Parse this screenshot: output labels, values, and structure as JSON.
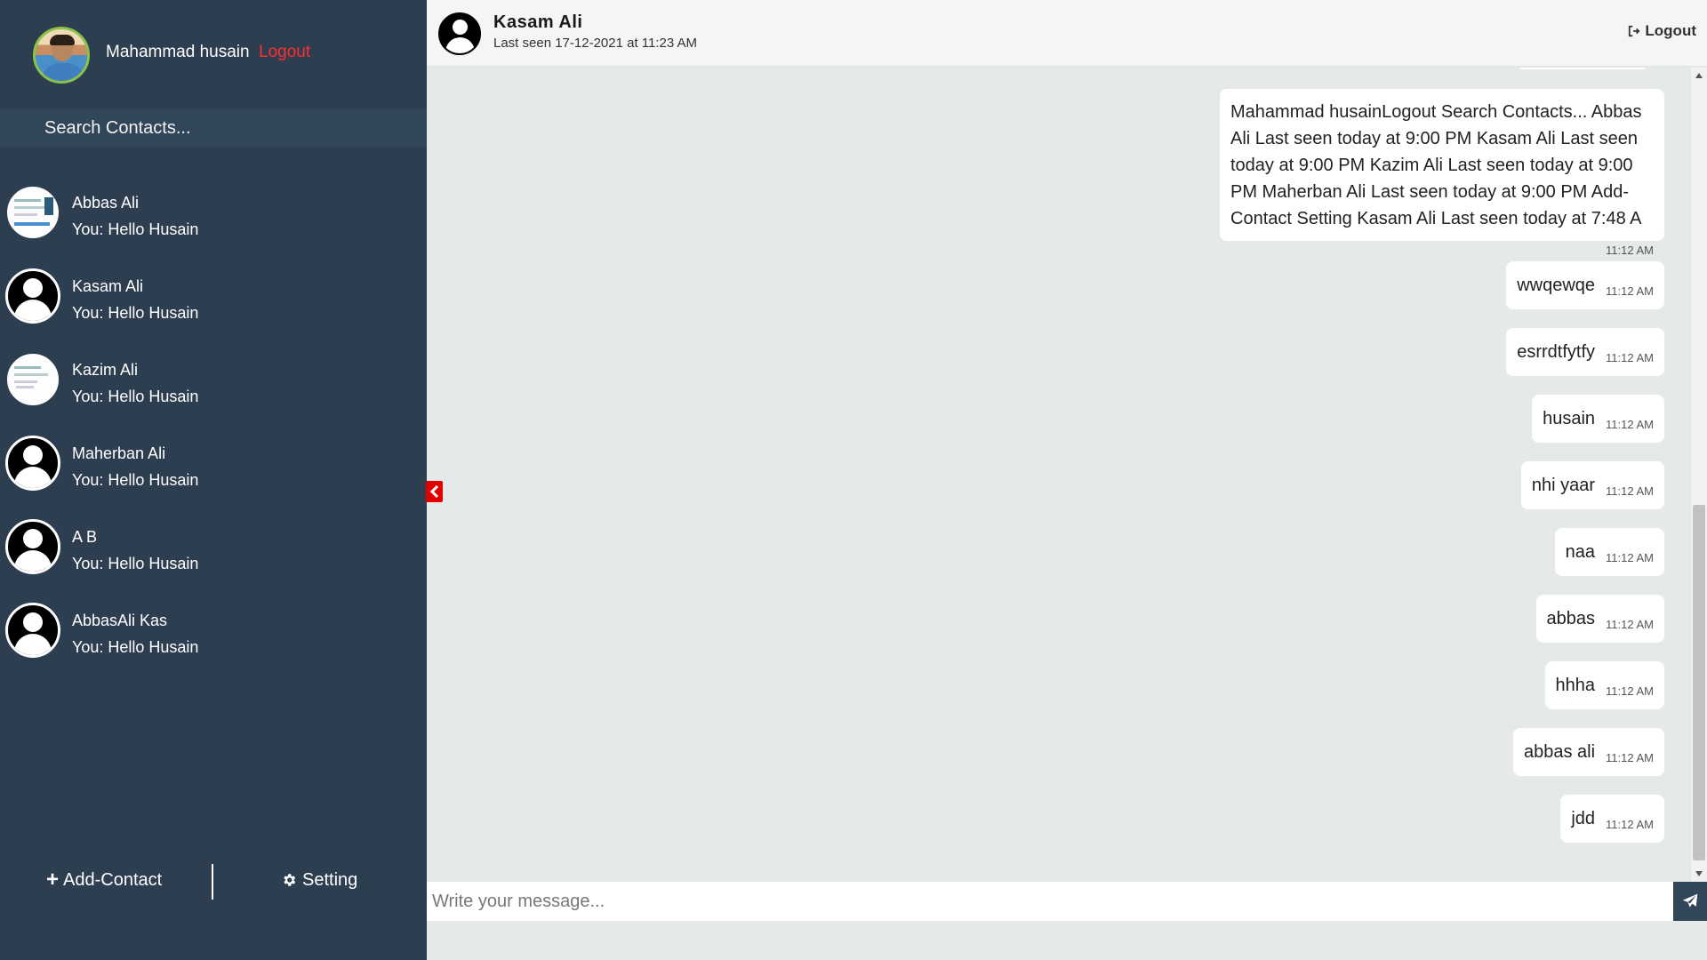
{
  "profile": {
    "name": "Mahammad husain",
    "logout_label": "Logout"
  },
  "search": {
    "placeholder": "Search Contacts..."
  },
  "contacts": [
    {
      "name": "Abbas Ali",
      "preview": "You: Hello Husain",
      "avatar": "screenshot-thumbnail"
    },
    {
      "name": "Kasam Ali",
      "preview": "You: Hello Husain",
      "avatar": "user-icon"
    },
    {
      "name": "Kazim Ali",
      "preview": "You: Hello Husain",
      "avatar": "screenshot-thumbnail"
    },
    {
      "name": "Maherban Ali",
      "preview": "You: Hello Husain",
      "avatar": "user-icon"
    },
    {
      "name": "A B",
      "preview": "You: Hello Husain",
      "avatar": "user-icon"
    },
    {
      "name": "AbbasAli Kas",
      "preview": "You: Hello Husain",
      "avatar": "user-icon"
    }
  ],
  "bottom": {
    "add_contact_label": "Add-Contact",
    "setting_label": "Setting"
  },
  "chat": {
    "title": "Kasam Ali",
    "status": "Last seen 17-12-2021 at 11:23 AM",
    "logout_label": "Logout",
    "composer_placeholder": "Write your message..."
  },
  "messages": [
    {
      "text": "Mahammad husainLogout Search Contacts... Abbas Ali Last seen today at 9:00 PM Kasam Ali Last seen today at 9:00 PM Kazim Ali Last seen today at 9:00 PM Maherban Ali Last seen today at 9:00 PM Add-Contact Setting Kasam Ali Last seen today at 7:48 A",
      "time": "11:12 AM"
    },
    {
      "text": "wwqewqe",
      "time": "11:12 AM"
    },
    {
      "text": "esrrdtfytfy",
      "time": "11:12 AM"
    },
    {
      "text": "husain",
      "time": "11:12 AM"
    },
    {
      "text": "nhi yaar",
      "time": "11:12 AM"
    },
    {
      "text": "naa",
      "time": "11:12 AM"
    },
    {
      "text": "abbas",
      "time": "11:12 AM"
    },
    {
      "text": "hhha",
      "time": "11:12 AM"
    },
    {
      "text": "abbas ali",
      "time": "11:12 AM"
    },
    {
      "text": "jdd",
      "time": "11:12 AM"
    }
  ],
  "colors": {
    "sidebar": "#2c3e50",
    "logout_red": "#ff2d2d",
    "collapse_red": "#e00000",
    "chat_bg": "#e6e9e9"
  }
}
